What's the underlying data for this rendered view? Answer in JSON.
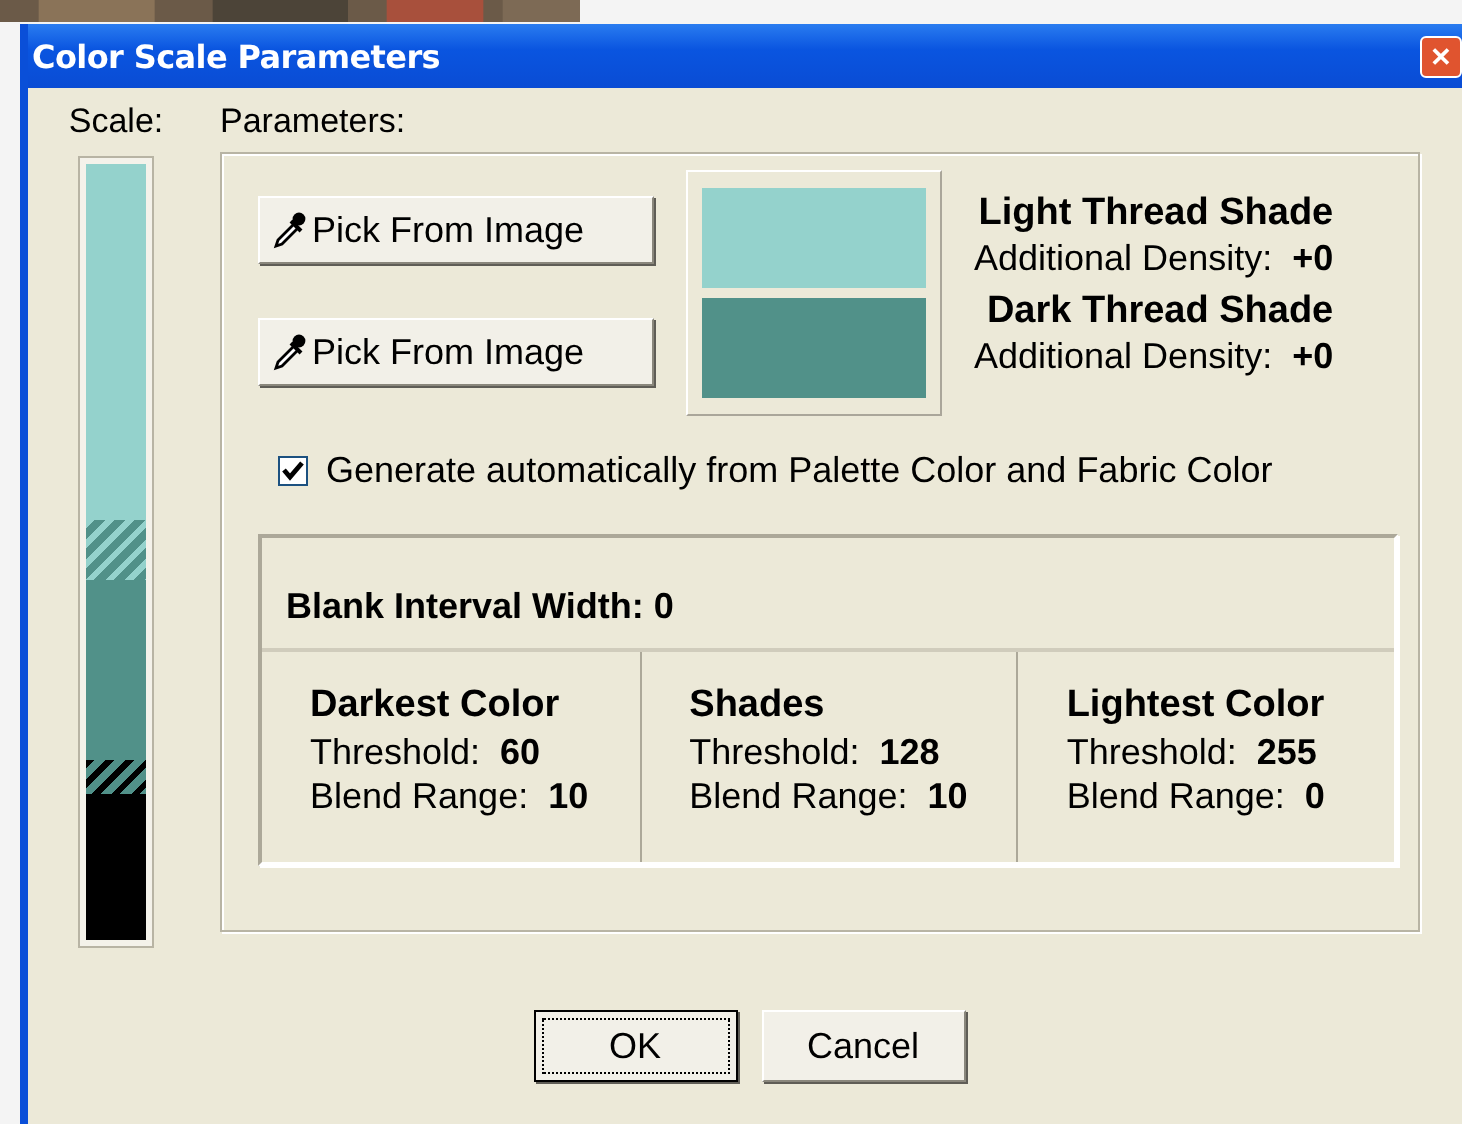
{
  "window": {
    "title": "Color Scale Parameters",
    "close": "✕"
  },
  "scale": {
    "label": "Scale:",
    "segments": [
      {
        "kind": "solid",
        "color": "#94d2cc"
      },
      {
        "kind": "hatched"
      },
      {
        "kind": "solid",
        "color": "#519189"
      },
      {
        "kind": "hatched"
      },
      {
        "kind": "solid",
        "color": "#000000"
      }
    ]
  },
  "parameters": {
    "label": "Parameters:",
    "shades": [
      {
        "button": "Pick From Image",
        "color": "#94d2cc",
        "title": "Light Thread Shade",
        "density_label": "Additional Density:",
        "density": "+0"
      },
      {
        "button": "Pick From Image",
        "color": "#519189",
        "title": "Dark Thread Shade",
        "density_label": "Additional Density:",
        "density": "+0"
      }
    ],
    "auto_generate": {
      "label": "Generate automatically from Palette Color and Fabric Color",
      "checked": true
    },
    "blank_interval": "Blank Interval Width: 0",
    "ranges": [
      {
        "title": "Darkest Color",
        "threshold_label": "Threshold:",
        "threshold": "60",
        "blend_label": "Blend Range:",
        "blend": "10"
      },
      {
        "title": "Shades",
        "threshold_label": "Threshold:",
        "threshold": "128",
        "blend_label": "Blend Range:",
        "blend": "10"
      },
      {
        "title": "Lightest Color",
        "threshold_label": "Threshold:",
        "threshold": "255",
        "blend_label": "Blend Range:",
        "blend": "0"
      }
    ]
  },
  "buttons": [
    {
      "label": "OK",
      "default": true
    },
    {
      "label": "Cancel",
      "default": false
    }
  ]
}
